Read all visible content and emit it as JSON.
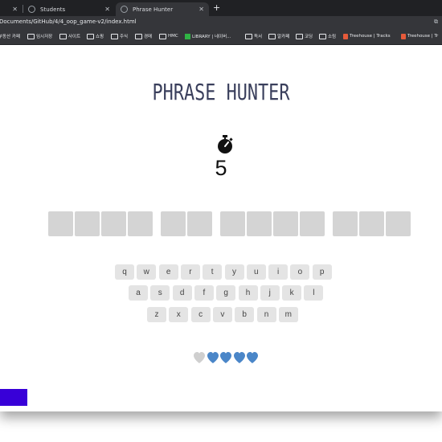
{
  "browser": {
    "tabs": [
      {
        "label": "",
        "active": false
      },
      {
        "label": "Students",
        "active": false
      },
      {
        "label": "Phrase Hunter",
        "active": true
      }
    ],
    "new_tab": "+",
    "url": "Documents/GitHub/4/4_oop_game-v2/index.html",
    "bookmarks": [
      "부동산 카페",
      "임시저장",
      "사이트",
      "쇼핑",
      "주식",
      "경매",
      "HMC",
      "LIBRARY | 네이버...",
      "독서",
      "알카페",
      "코딩",
      "소림",
      "Treehouse | Tracks",
      "Treehouse | Tr"
    ]
  },
  "game": {
    "title": "PHRASE HUNTER",
    "timer": "5",
    "phrase_words": [
      4,
      2,
      4,
      3
    ],
    "keyboard": {
      "row1": [
        "q",
        "w",
        "e",
        "r",
        "t",
        "y",
        "u",
        "i",
        "o",
        "p"
      ],
      "row2": [
        "a",
        "s",
        "d",
        "f",
        "g",
        "h",
        "j",
        "k",
        "l"
      ],
      "row3": [
        "z",
        "x",
        "c",
        "v",
        "b",
        "n",
        "m"
      ]
    },
    "lives": {
      "lost": 1,
      "remaining": 4
    },
    "colors": {
      "title": "#3a3f5c",
      "heart_live": "#4a86c8",
      "heart_lost": "#cfcfcf",
      "tile": "#d4d4d4",
      "key": "#e4e4e4",
      "accent_bar": "#3800d8"
    }
  }
}
